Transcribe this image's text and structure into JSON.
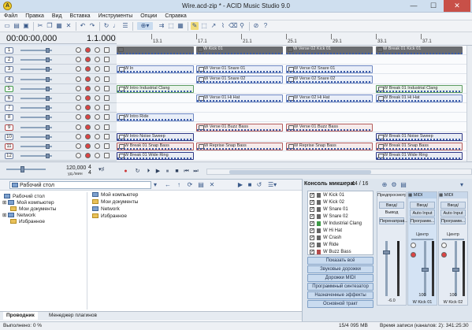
{
  "window": {
    "title": "Wire.acd-zip * - ACID Music Studio 9.0",
    "app_icon": "acid-logo-icon",
    "minimize": "—",
    "maximize": "☐",
    "close": "✕"
  },
  "menu": [
    "Файл",
    "Правка",
    "Вид",
    "Вставка",
    "Инструменты",
    "Опции",
    "Справка"
  ],
  "header": {
    "time": "00:00:00,000",
    "beat": "1.1.000"
  },
  "ruler": [
    "13.1",
    "17.1",
    "21.1",
    "25.1",
    "29.1",
    "33.1",
    "37.1"
  ],
  "tracks": [
    {
      "num": "1",
      "color": "#6b7ea3"
    },
    {
      "num": "2",
      "color": "#6b7ea3"
    },
    {
      "num": "3",
      "color": "#6b7ea3"
    },
    {
      "num": "4",
      "color": "#6b7ea3"
    },
    {
      "num": "5",
      "color": "#3d9a46"
    },
    {
      "num": "6",
      "color": "#6b7ea3"
    },
    {
      "num": "7",
      "color": "#6b7ea3"
    },
    {
      "num": "8",
      "color": "#6b7ea3"
    },
    {
      "num": "9",
      "color": "#b44a4a"
    },
    {
      "num": "10",
      "color": "#6b7ea3"
    },
    {
      "num": "11",
      "color": "#b44a4a"
    },
    {
      "num": "12",
      "color": "#6b7ea3"
    }
  ],
  "clips": [
    {
      "row": 0,
      "col": 0,
      "label": "",
      "style": "cgray"
    },
    {
      "row": 0,
      "col": 1,
      "label": "W Kick 01",
      "style": "cgray"
    },
    {
      "row": 0,
      "col": 2,
      "label": "W Verse 02 Kick 01",
      "style": "cgray"
    },
    {
      "row": 0,
      "col": 3,
      "label": "W Break 01 Kick 01",
      "style": "cgray"
    },
    {
      "row": 2,
      "col": 0,
      "label": "W In",
      "style": "cblue"
    },
    {
      "row": 2,
      "col": 1,
      "label": "W Verse 01 Snare 01",
      "style": "cblue"
    },
    {
      "row": 2,
      "col": 2,
      "label": "W Verse 02 Snare 01",
      "style": "cblue"
    },
    {
      "row": 3,
      "col": 1,
      "label": "W Verse 01 Snare 02",
      "style": "cblue"
    },
    {
      "row": 3,
      "col": 2,
      "label": "W Verse 02 Snare 02",
      "style": "cblue"
    },
    {
      "row": 4,
      "col": 0,
      "label": "W Intro Industrial Clang",
      "style": "cgreen"
    },
    {
      "row": 4,
      "col": 3,
      "label": "W Break 01 Industrial Clang",
      "style": "cgreen"
    },
    {
      "row": 5,
      "col": 1,
      "label": "W Verse 01 Hi Hat",
      "style": "cblue"
    },
    {
      "row": 5,
      "col": 2,
      "label": "W Verse 02 Hi Hat",
      "style": "cblue"
    },
    {
      "row": 5,
      "col": 3,
      "label": "W Break 01 Hi Hat",
      "style": "cblue"
    },
    {
      "row": 7,
      "col": 0,
      "label": "W Intro Ride",
      "style": "cblue"
    },
    {
      "row": 8,
      "col": 1,
      "label": "W Verse 01 Buzz Bass",
      "style": "cred"
    },
    {
      "row": 8,
      "col": 2,
      "label": "W Verse 01 Buzz Bass",
      "style": "cred"
    },
    {
      "row": 9,
      "col": 0,
      "label": "W Intro Noise Sweep",
      "style": "cnavy"
    },
    {
      "row": 9,
      "col": 3,
      "label": "W Break 01 Noise Sweep",
      "style": "cnavy"
    },
    {
      "row": 10,
      "col": 0,
      "label": "W Break 01 Snap Bass",
      "style": "cred"
    },
    {
      "row": 10,
      "col": 1,
      "label": "W Reprise Snap Bass",
      "style": "cred"
    },
    {
      "row": 10,
      "col": 2,
      "label": "W Reprise Snap Bass",
      "style": "cred"
    },
    {
      "row": 10,
      "col": 3,
      "label": "W Break 01 Snap Bass",
      "style": "cred"
    },
    {
      "row": 11,
      "col": 0,
      "label": "W Break 01 Wide Ring",
      "style": "cnavy"
    },
    {
      "row": 11,
      "col": 3,
      "label": "W Break 01 Wide Ring",
      "style": "cnavy"
    }
  ],
  "transport": {
    "tempo": "120,000",
    "tempo_unit": "уд./мин",
    "time_sig_top": "4",
    "time_sig_bottom": "4",
    "buttons": [
      "record-icon",
      "loop-icon",
      "play-from-start-icon",
      "play-icon",
      "pause-icon",
      "stop-icon",
      "go-start-icon",
      "go-end-icon"
    ]
  },
  "explorer": {
    "path": "Рабочий стол",
    "tree": [
      "Рабочий стол",
      "Мой компьютер",
      "Мои документы",
      "Network",
      "Избранное"
    ],
    "files": [
      "Мой компьютер",
      "Мои документы",
      "Network",
      "Избранное"
    ],
    "tabs": [
      "Проводник",
      "Менеджер плагинов"
    ]
  },
  "mixer": {
    "title": "Консоль микшера:",
    "count": "44 / 16",
    "tracks": [
      "W Kick 01",
      "W Kick 02",
      "W Snare 01",
      "W Snare 02",
      "W Industrial Clang",
      "W Hi Hat",
      "W Crash",
      "W Ride",
      "W Buzz Bass"
    ],
    "buttons": [
      "Показать всё",
      "Звуковые дорожки",
      "Дорожки MIDI",
      "Программный синтезатор",
      "Назначенные эффекты",
      "Основной тракт"
    ],
    "strips": [
      {
        "name": "Предпросмотр",
        "io": "Ввод/Вывод",
        "btn": "Перенаправ...",
        "value": "-6.0"
      },
      {
        "name": "MIDI",
        "io": "Ввод/Вывод",
        "btn": "Auto Input",
        "btn2": "Программ...",
        "pan": "Центр",
        "value": "100",
        "label": "W Kick 01"
      },
      {
        "name": "MIDI",
        "io": "Ввод/Вывод",
        "btn": "Auto Input",
        "btn2": "Программ...",
        "pan": "Центр",
        "value": "100",
        "label": "W Kick 02"
      }
    ]
  },
  "status": {
    "left": "Выполнено: 0 %",
    "center": "15/4 095 MB",
    "right": "Время записи (каналов: 2): 341:25:30"
  }
}
